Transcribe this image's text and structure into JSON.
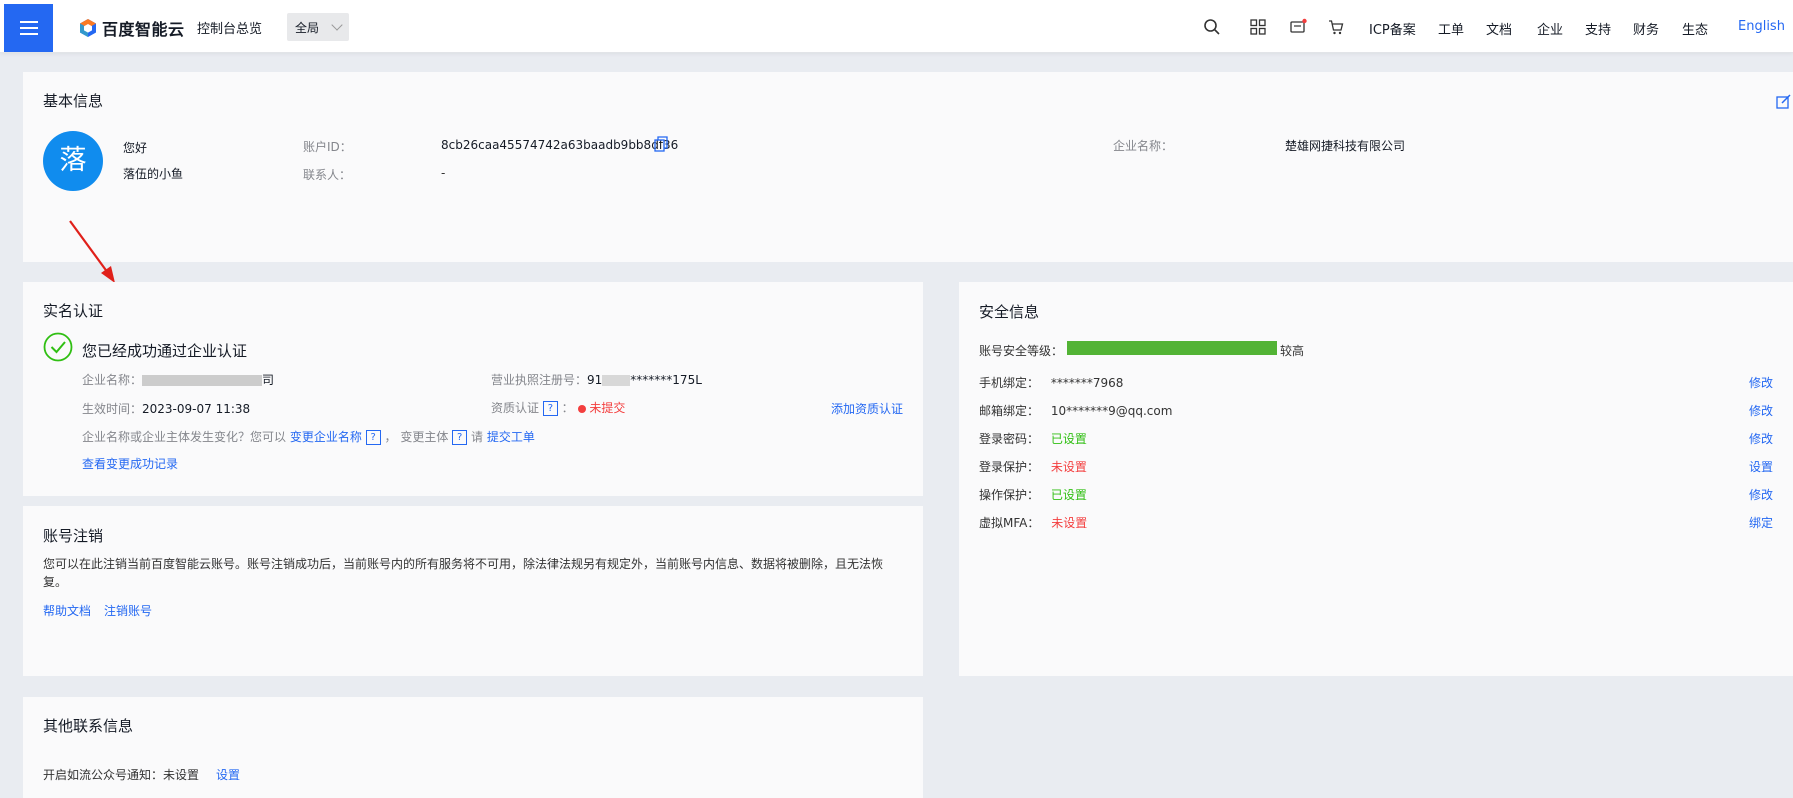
{
  "topbar": {
    "brand": "百度智能云",
    "console_overview": "控制台总览",
    "region": "全局",
    "nav": [
      "ICP备案",
      "工单",
      "文档",
      "企业",
      "支持",
      "财务",
      "生态"
    ],
    "language": "English"
  },
  "basic_info": {
    "title": "基本信息",
    "avatar_char": "落",
    "greeting": "您好",
    "username": "落伍的小鱼",
    "account_id_label": "账户ID：",
    "account_id": "8cb26caa45574742a63baadb9bb8df36",
    "contact_label": "联系人：",
    "contact": "-",
    "company_label": "企业名称：",
    "company": "楚雄网捷科技有限公司"
  },
  "realname": {
    "title": "实名认证",
    "status": "您已经成功通过企业认证",
    "company_label": "企业名称：",
    "company_suffix": "司",
    "license_label": "营业执照注册号：",
    "license_prefix": "91",
    "license_suffix": "*******175L",
    "effective_label": "生效时间：",
    "effective_time": "2023-09-07 11:38",
    "qualification_label": "资质认证",
    "qualification_colon": "：",
    "qualification_status": "未提交",
    "add_qualification": "添加资质认证",
    "change_text_1": "企业名称或企业主体发生变化？您可以",
    "change_company_link": "变更企业名称",
    "change_text_2": "，  变更主体",
    "change_text_3": "请",
    "submit_ticket_link": "提交工单",
    "view_records_link": "查看变更成功记录",
    "help_mark": "?"
  },
  "cancel_account": {
    "title": "账号注销",
    "description_line1": "您可以在此注销当前百度智能云账号。账号注销成功后，当前账号内的所有服务将不可用，除法律法规另有规定外，当前账号内信息、数据将被删除，且无法恢",
    "description_line2": "复。",
    "help_link": "帮助文档",
    "cancel_link": "注销账号"
  },
  "security": {
    "title": "安全信息",
    "level_label": "账号安全等级：",
    "level_text": "较高",
    "level_fraction": 1.0,
    "rows": [
      {
        "label": "手机绑定：",
        "value": "*******7968",
        "action": "修改"
      },
      {
        "label": "邮箱绑定：",
        "value": "10*******9@qq.com",
        "action": "修改"
      },
      {
        "label": "登录密码：",
        "value": "已设置",
        "action": "修改"
      },
      {
        "label": "登录保护：",
        "value": "未设置",
        "action": "设置"
      },
      {
        "label": "操作保护：",
        "value": "已设置",
        "action": "修改"
      },
      {
        "label": "虚拟MFA：",
        "value": "未设置",
        "action": "绑定"
      }
    ]
  },
  "other_contact": {
    "title": "其他联系信息",
    "notify_label": "开启如流公众号通知：",
    "notify_value": "未设置",
    "notify_action": "设置"
  },
  "colors": {
    "primary": "#2468f2",
    "success": "#30bf13",
    "danger": "#f33e3e",
    "security_bar": "#52b335",
    "annotation_arrow": "#e0201a"
  }
}
